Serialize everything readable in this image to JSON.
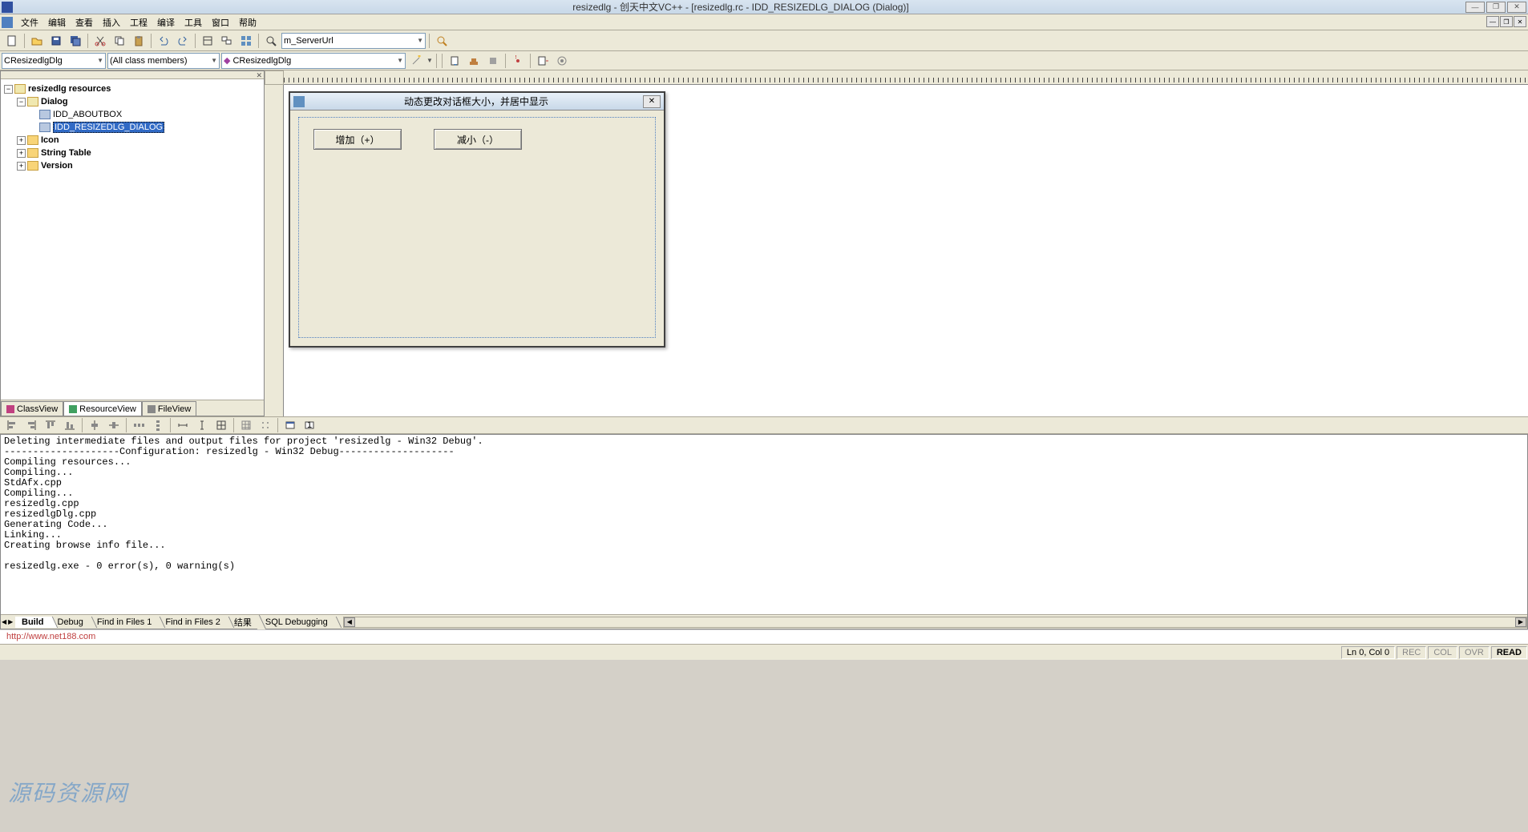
{
  "title": "resizedlg - 创天中文VC++ - [resizedlg.rc - IDD_RESIZEDLG_DIALOG (Dialog)]",
  "menu": [
    "文件",
    "编辑",
    "查看",
    "插入",
    "工程",
    "编译",
    "工具",
    "窗口",
    "帮助"
  ],
  "combo_mserver": "m_ServerUrl",
  "class_combo1": "CResizedlgDlg",
  "class_combo2": "(All class members)",
  "class_combo3": "CResizedlgDlg",
  "tree": {
    "root": "resizedlg resources",
    "dialog_folder": "Dialog",
    "dlg_about": "IDD_ABOUTBOX",
    "dlg_resize": "IDD_RESIZEDLG_DIALOG",
    "icon_folder": "Icon",
    "string_folder": "String Table",
    "version_folder": "Version"
  },
  "tree_tabs": {
    "class": "ClassView",
    "resource": "ResourceView",
    "file": "FileView"
  },
  "dialog": {
    "title": "动态更改对话框大小，并居中显示",
    "btn_inc": "增加（+）",
    "btn_dec": "减小（-）"
  },
  "output_text": "Deleting intermediate files and output files for project 'resizedlg - Win32 Debug'.\n--------------------Configuration: resizedlg - Win32 Debug--------------------\nCompiling resources...\nCompiling...\nStdAfx.cpp\nCompiling...\nresizedlg.cpp\nresizedlgDlg.cpp\nGenerating Code...\nLinking...\nCreating browse info file...\n\nresizedlg.exe - 0 error(s), 0 warning(s)",
  "output_tabs": {
    "build": "Build",
    "debug": "Debug",
    "fif1": "Find in Files 1",
    "fif2": "Find in Files 2",
    "result": "结果",
    "sql": "SQL Debugging"
  },
  "watermark": "源码资源网",
  "footer_link": "http://www.net188.com",
  "status": {
    "pos": "Ln 0, Col 0",
    "rec": "REC",
    "col": "COL",
    "ovr": "OVR",
    "read": "READ"
  }
}
